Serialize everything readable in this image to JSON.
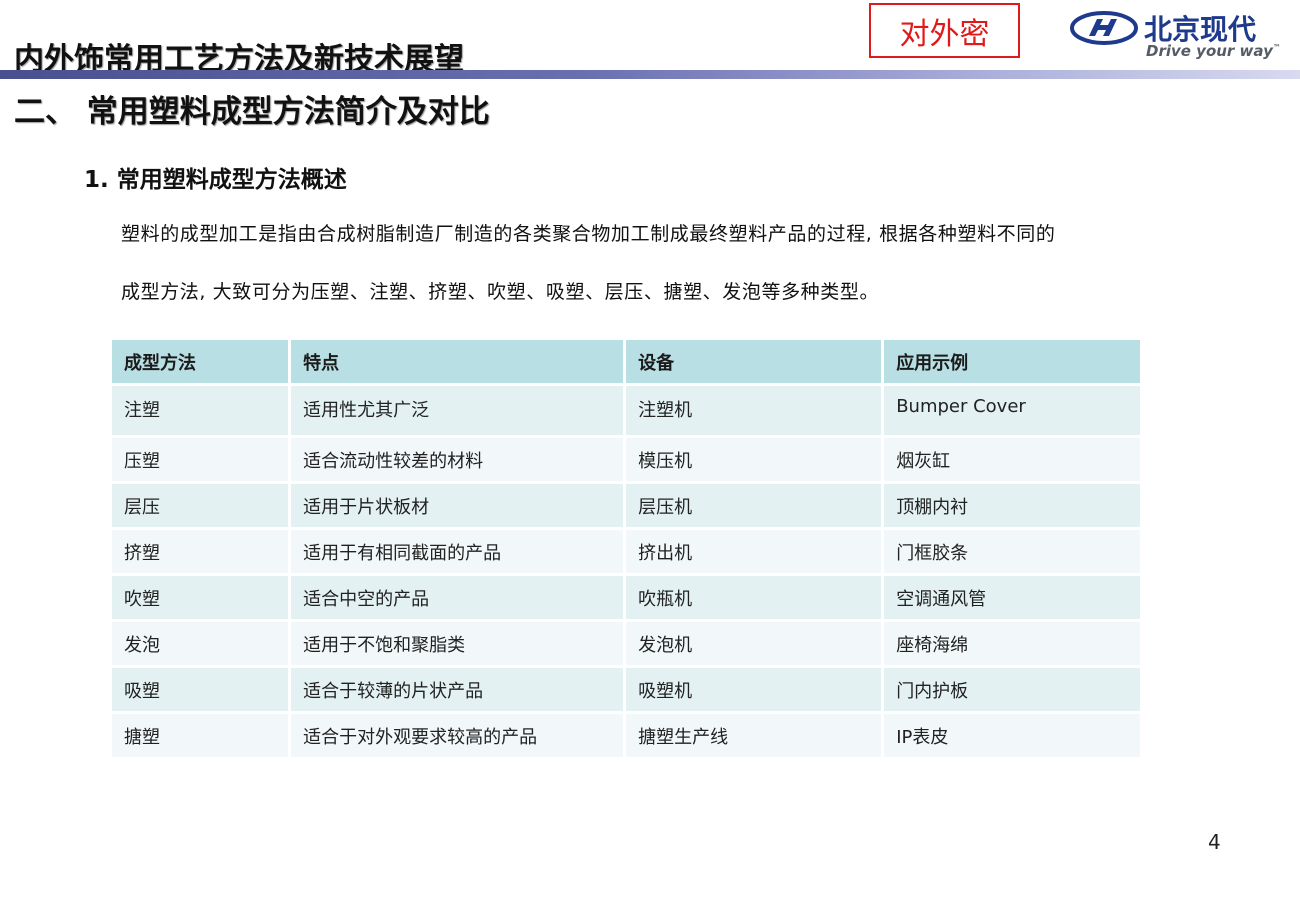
{
  "header": {
    "main_title": "内外饰常用工艺方法及新技术展望",
    "confidential_label": "对外密",
    "logo": {
      "brand_cn": "北京现代",
      "slogan": "Drive your way",
      "trademark": "™"
    }
  },
  "section": {
    "title": "二、 常用塑料成型方法简介及对比",
    "subtitle": "1. 常用塑料成型方法概述",
    "paragraph_line1": "塑料的成型加工是指由合成树脂制造厂制造的各类聚合物加工制成最终塑料产品的过程, 根据各种塑料不同的",
    "paragraph_line2": "成型方法, 大致可分为压塑、注塑、挤塑、吹塑、吸塑、层压、搪塑、发泡等多种类型。"
  },
  "table": {
    "headers": [
      "成型方法",
      "特点",
      "设备",
      "应用示例"
    ],
    "rows": [
      [
        "注塑",
        "适用性尤其广泛",
        "注塑机",
        "Bumper Cover"
      ],
      [
        "压塑",
        "适合流动性较差的材料",
        "模压机",
        "烟灰缸"
      ],
      [
        "层压",
        "适用于片状板材",
        "层压机",
        "顶棚内衬"
      ],
      [
        "挤塑",
        "适用于有相同截面的产品",
        "挤出机",
        "门框胶条"
      ],
      [
        "吹塑",
        "适合中空的产品",
        "吹瓶机",
        "空调通风管"
      ],
      [
        "发泡",
        "适用于不饱和聚脂类",
        "发泡机",
        "座椅海绵"
      ],
      [
        "吸塑",
        "适合于较薄的片状产品",
        "吸塑机",
        "门内护板"
      ],
      [
        "搪塑",
        "适合于对外观要求较高的产品",
        "搪塑生产线",
        "IP表皮"
      ]
    ]
  },
  "page_number": "4",
  "colors": {
    "accent_rule": "#4a4f8f",
    "confidential_red": "#e01a1a",
    "header_cell": "#b8dfe3",
    "row_dark": "#e3f1f2",
    "row_light": "#f2f8f9",
    "logo_blue": "#1e3a8c"
  }
}
